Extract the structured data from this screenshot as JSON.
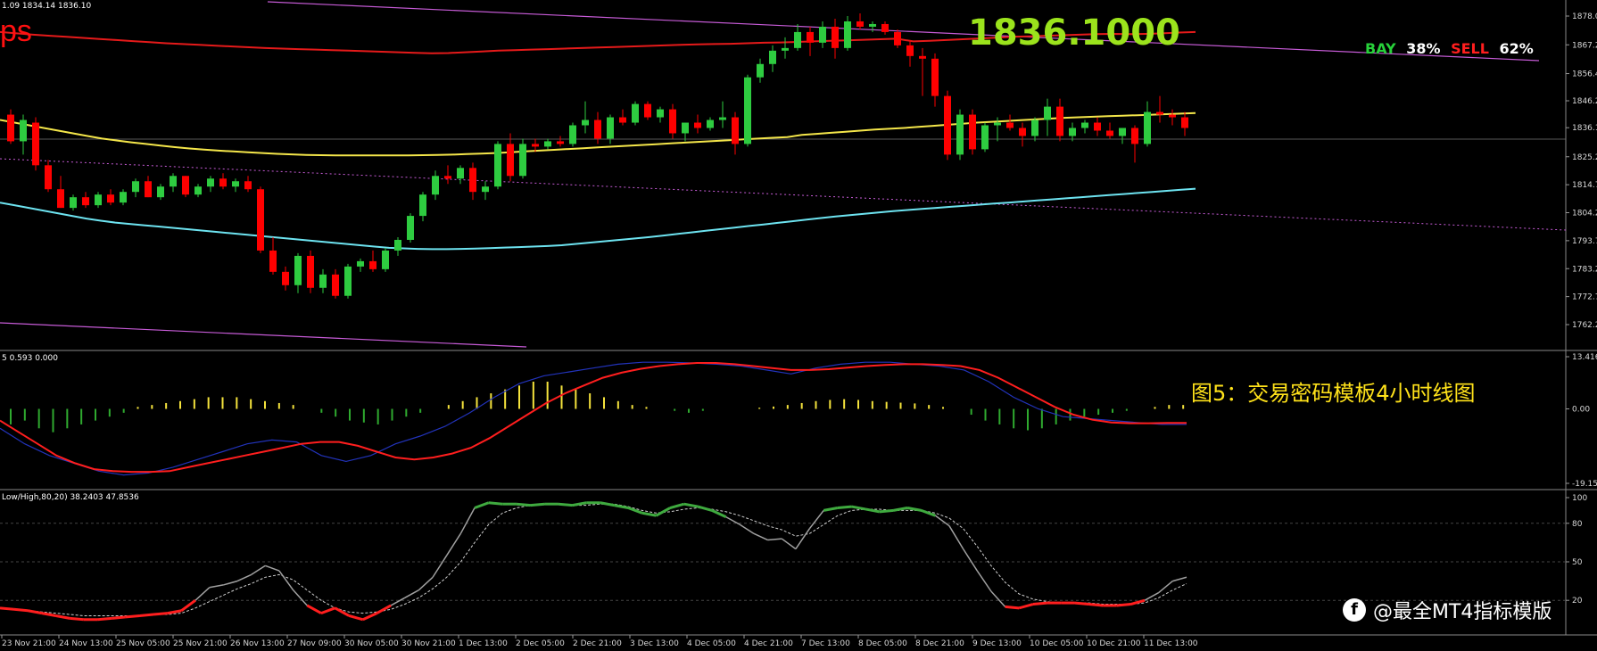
{
  "chart_header": {
    "main_info": "1.09 1834.14 1836.10",
    "logo_fragment": "ps",
    "current_price": "1836.1000",
    "buy_label": "BAY",
    "buy_pct": "38%",
    "sell_label": "SELL",
    "sell_pct": "62%",
    "macd_info": "5 0.593 0.000",
    "stoch_info": "Low/High,80,20) 38.2403 47.8536"
  },
  "caption": "图5：交易密码模板4小时线图",
  "watermark": "@最全MT4指标模版",
  "price_axis": [
    "1878.00",
    "1867.20",
    "1856.40",
    "1846.20",
    "1836.10",
    "1825.20",
    "1814.70",
    "1804.20",
    "1793.70",
    "1783.20",
    "1772.70",
    "1762.20"
  ],
  "macd_axis": [
    "13.416",
    "0.00",
    "-19.15"
  ],
  "stoch_axis": [
    "100",
    "80",
    "50",
    "20",
    "0"
  ],
  "time_axis": [
    "23 Nov 21:00",
    "24 Nov 13:00",
    "25 Nov 05:00",
    "25 Nov 21:00",
    "26 Nov 13:00",
    "27 Nov 09:00",
    "30 Nov 05:00",
    "30 Nov 21:00",
    "1 Dec 13:00",
    "2 Dec 05:00",
    "2 Dec 21:00",
    "3 Dec 13:00",
    "4 Dec 05:00",
    "4 Dec 21:00",
    "7 Dec 13:00",
    "8 Dec 05:00",
    "8 Dec 21:00",
    "9 Dec 13:00",
    "10 Dec 05:00",
    "10 Dec 21:00",
    "11 Dec 13:00"
  ],
  "colors": {
    "bull": "#2ecc40",
    "bear": "#ff0000",
    "ma_red": "#e51a1a",
    "ma_yellow": "#f4e64a",
    "ma_cyan": "#6de3f0",
    "channel_violet": "#c65bd6",
    "macd_bar_pos": "#f5e33c",
    "macd_bar_neg": "#2faa2f",
    "macd_signal": "#ff1e1e",
    "macd_main": "#2233bb",
    "stoch_main_grey": "#a0a0a0",
    "stoch_hot": "#3faa3f",
    "stoch_cold": "#ff1e1e",
    "grid": "#3a3a3a",
    "accent_green": "#9be31c",
    "caption_yellow": "#ffe21a"
  },
  "chart_data": [
    {
      "type": "candlestick",
      "title": "",
      "ylim": [
        1762.2,
        1878.0
      ],
      "candles": [
        [
          1841,
          1843,
          1830,
          1831
        ],
        [
          1831,
          1841,
          1826,
          1839
        ],
        [
          1838,
          1840,
          1820,
          1822
        ],
        [
          1822,
          1824,
          1812,
          1813
        ],
        [
          1813,
          1818,
          1806,
          1806
        ],
        [
          1806,
          1811,
          1805,
          1810
        ],
        [
          1810,
          1812,
          1806,
          1807
        ],
        [
          1807,
          1812,
          1806,
          1811
        ],
        [
          1811,
          1813,
          1807,
          1808
        ],
        [
          1808,
          1813,
          1807,
          1812
        ],
        [
          1812,
          1817,
          1810,
          1816
        ],
        [
          1816,
          1818,
          1810,
          1810
        ],
        [
          1810,
          1815,
          1809,
          1814
        ],
        [
          1814,
          1819,
          1812,
          1818
        ],
        [
          1818,
          1818,
          1810,
          1811
        ],
        [
          1811,
          1815,
          1810,
          1814
        ],
        [
          1814,
          1818,
          1812,
          1817
        ],
        [
          1817,
          1819,
          1813,
          1814
        ],
        [
          1814,
          1817,
          1812,
          1816
        ],
        [
          1816,
          1818,
          1812,
          1813
        ],
        [
          1813,
          1814,
          1789,
          1790
        ],
        [
          1790,
          1795,
          1781,
          1782
        ],
        [
          1782,
          1784,
          1775,
          1777
        ],
        [
          1777,
          1789,
          1774,
          1788
        ],
        [
          1788,
          1790,
          1774,
          1776
        ],
        [
          1776,
          1783,
          1774,
          1781
        ],
        [
          1781,
          1783,
          1772,
          1773
        ],
        [
          1773,
          1785,
          1772,
          1784
        ],
        [
          1784,
          1787,
          1782,
          1786
        ],
        [
          1786,
          1790,
          1782,
          1783
        ],
        [
          1783,
          1791,
          1782,
          1790
        ],
        [
          1790,
          1795,
          1788,
          1794
        ],
        [
          1794,
          1804,
          1793,
          1803
        ],
        [
          1803,
          1812,
          1801,
          1811
        ],
        [
          1811,
          1820,
          1809,
          1818
        ],
        [
          1818,
          1822,
          1815,
          1817
        ],
        [
          1817,
          1822,
          1815,
          1821
        ],
        [
          1821,
          1823,
          1809,
          1812
        ],
        [
          1812,
          1816,
          1809,
          1814
        ],
        [
          1814,
          1831,
          1813,
          1830
        ],
        [
          1830,
          1834,
          1816,
          1818
        ],
        [
          1818,
          1832,
          1817,
          1830
        ],
        [
          1830,
          1832,
          1827,
          1829
        ],
        [
          1829,
          1832,
          1828,
          1831
        ],
        [
          1831,
          1833,
          1829,
          1830
        ],
        [
          1830,
          1838,
          1829,
          1837
        ],
        [
          1837,
          1846,
          1834,
          1839
        ],
        [
          1839,
          1842,
          1830,
          1832
        ],
        [
          1832,
          1841,
          1830,
          1840
        ],
        [
          1840,
          1843,
          1837,
          1838
        ],
        [
          1838,
          1846,
          1837,
          1845
        ],
        [
          1845,
          1846,
          1839,
          1840
        ],
        [
          1840,
          1844,
          1838,
          1843
        ],
        [
          1843,
          1845,
          1832,
          1834
        ],
        [
          1834,
          1838,
          1831,
          1838
        ],
        [
          1838,
          1841,
          1834,
          1836
        ],
        [
          1836,
          1840,
          1835,
          1839
        ],
        [
          1839,
          1846,
          1836,
          1840
        ],
        [
          1840,
          1842,
          1826,
          1830
        ],
        [
          1830,
          1856,
          1829,
          1855
        ],
        [
          1855,
          1862,
          1853,
          1860
        ],
        [
          1860,
          1867,
          1857,
          1865
        ],
        [
          1865,
          1870,
          1862,
          1866
        ],
        [
          1866,
          1875,
          1865,
          1872
        ],
        [
          1872,
          1874,
          1863,
          1868
        ],
        [
          1868,
          1876,
          1866,
          1874
        ],
        [
          1874,
          1877,
          1862,
          1866
        ],
        [
          1866,
          1878,
          1865,
          1876
        ],
        [
          1876,
          1879,
          1873,
          1874
        ],
        [
          1874,
          1876,
          1872,
          1875
        ],
        [
          1875,
          1876,
          1871,
          1872
        ],
        [
          1872,
          1873,
          1866,
          1867
        ],
        [
          1867,
          1869,
          1859,
          1863
        ],
        [
          1863,
          1866,
          1848,
          1862
        ],
        [
          1862,
          1864,
          1844,
          1848
        ],
        [
          1848,
          1850,
          1824,
          1826
        ],
        [
          1826,
          1843,
          1824,
          1841
        ],
        [
          1841,
          1843,
          1826,
          1828
        ],
        [
          1828,
          1838,
          1827,
          1837
        ],
        [
          1837,
          1840,
          1831,
          1838
        ],
        [
          1838,
          1841,
          1835,
          1836
        ],
        [
          1836,
          1838,
          1829,
          1833
        ],
        [
          1833,
          1840,
          1831,
          1839
        ],
        [
          1839,
          1847,
          1833,
          1844
        ],
        [
          1844,
          1847,
          1831,
          1833
        ],
        [
          1833,
          1838,
          1831,
          1836
        ],
        [
          1836,
          1839,
          1834,
          1838
        ],
        [
          1838,
          1840,
          1833,
          1835
        ],
        [
          1835,
          1838,
          1832,
          1833
        ],
        [
          1833,
          1836,
          1830,
          1836
        ],
        [
          1836,
          1837,
          1823,
          1830
        ],
        [
          1830,
          1846,
          1829,
          1842
        ],
        [
          1842,
          1848,
          1838,
          1841
        ],
        [
          1841,
          1843,
          1837,
          1840
        ],
        [
          1840,
          1842,
          1833,
          1836
        ]
      ],
      "ma_red": [
        1872,
        1871.5,
        1871,
        1870.6,
        1870.2,
        1869.8,
        1869.4,
        1869,
        1868.6,
        1868.2,
        1867.8,
        1867.5,
        1867.2,
        1866.9,
        1866.6,
        1866.3,
        1866,
        1865.8,
        1865.6,
        1865.4,
        1865.2,
        1865,
        1864.8,
        1864.6,
        1864.4,
        1864.2,
        1864,
        1864.1,
        1864.4,
        1864.7,
        1865,
        1865.2,
        1865.4,
        1865.6,
        1865.8,
        1866,
        1866.2,
        1866.4,
        1866.6,
        1866.8,
        1867,
        1867.2,
        1867.4,
        1867.5,
        1867.6,
        1867.8,
        1868,
        1868.1,
        1868.3,
        1868.5,
        1868.7,
        1868.9,
        1869.1,
        1869.3,
        1869.5,
        1868.5,
        1868.7,
        1869,
        1869.3,
        1869.6,
        1869.9,
        1870.2,
        1870.4,
        1870.6,
        1870.8,
        1871,
        1871.2,
        1871.3,
        1871.2,
        1871.3,
        1871.5,
        1871.8,
        1872
      ],
      "ma_yellow": [
        1839,
        1838,
        1837,
        1836,
        1835,
        1834,
        1833,
        1832,
        1831.3,
        1830.6,
        1830,
        1829.4,
        1828.8,
        1828.3,
        1827.9,
        1827.5,
        1827.2,
        1826.9,
        1826.6,
        1826.3,
        1826.1,
        1825.9,
        1825.8,
        1825.7,
        1825.7,
        1825.7,
        1825.7,
        1825.7,
        1825.7,
        1825.8,
        1825.9,
        1826,
        1826.2,
        1826.4,
        1826.6,
        1826.9,
        1827.2,
        1827.5,
        1827.8,
        1828.1,
        1828.4,
        1828.7,
        1829,
        1829.3,
        1829.6,
        1829.9,
        1830.2,
        1830.5,
        1830.8,
        1831.1,
        1831.4,
        1831.7,
        1832,
        1832.3,
        1832.6,
        1833.4,
        1833.8,
        1834.2,
        1834.6,
        1835,
        1835.4,
        1835.7,
        1836,
        1836.4,
        1836.8,
        1837.2,
        1837.6,
        1838,
        1838.3,
        1838.6,
        1838.9,
        1839.2,
        1839.5,
        1839.8,
        1840,
        1840.2,
        1840.4,
        1840.6,
        1840.8,
        1841,
        1841.2,
        1841.4,
        1841.6
      ],
      "ma_cyan": [
        1808,
        1807,
        1806,
        1805,
        1804,
        1803,
        1802,
        1801.2,
        1800.5,
        1800,
        1799.5,
        1799,
        1798.5,
        1798,
        1797.5,
        1797,
        1796.5,
        1796,
        1795.5,
        1795,
        1794.5,
        1794,
        1793.5,
        1793,
        1792.5,
        1792,
        1791.5,
        1791,
        1790.8,
        1790.6,
        1790.5,
        1790.5,
        1790.6,
        1790.7,
        1790.9,
        1791.1,
        1791.3,
        1791.5,
        1791.7,
        1792,
        1792.5,
        1793,
        1793.5,
        1794,
        1794.5,
        1795,
        1795.6,
        1796.2,
        1796.8,
        1797.4,
        1798,
        1798.6,
        1799.2,
        1799.8,
        1800.4,
        1801,
        1801.6,
        1802.2,
        1802.8,
        1803.3,
        1803.8,
        1804.3,
        1804.8,
        1805.2,
        1805.6,
        1806,
        1806.4,
        1806.8,
        1807.2,
        1807.6,
        1808,
        1808.4,
        1808.8,
        1809.2,
        1809.6,
        1810,
        1810.4,
        1810.8,
        1811.2,
        1811.6,
        1812,
        1812.4,
        1812.8,
        1813.2
      ]
    },
    {
      "type": "bar",
      "title": "MACD",
      "ylim": [
        -19.15,
        13.416
      ],
      "hist": [
        -4,
        -3,
        -5,
        -6,
        -5,
        -4,
        -3,
        -2,
        -1,
        0.5,
        1,
        1.5,
        2,
        2.5,
        3,
        3,
        3,
        2.5,
        2,
        1.5,
        1,
        0,
        -1,
        -2,
        -3,
        -3.5,
        -4,
        -3,
        -2,
        -1,
        0,
        1,
        2,
        3,
        4,
        5,
        6,
        7,
        7,
        6,
        5,
        4,
        3,
        2,
        1,
        0.5,
        0,
        -0.5,
        -1,
        -0.5,
        0,
        0,
        0,
        0.3,
        0.6,
        1,
        1.5,
        2,
        2.3,
        2.5,
        2.3,
        2,
        1.8,
        1.6,
        1.4,
        1,
        0.5,
        0,
        -1.5,
        -3,
        -4,
        -5,
        -5.5,
        -5,
        -4,
        -3,
        -2,
        -1.5,
        -1,
        -0.5,
        0,
        0.5,
        1,
        1
      ],
      "signal": [
        -3,
        -6,
        -9,
        -12,
        -14,
        -15.5,
        -16,
        -16.2,
        -16.2,
        -16,
        -15,
        -14,
        -13,
        -12,
        -11,
        -10,
        -9,
        -8.5,
        -8.5,
        -9.5,
        -11,
        -12.5,
        -13,
        -12.5,
        -11.5,
        -10,
        -7.5,
        -4.5,
        -1.5,
        1.5,
        4,
        6,
        8,
        9.3,
        10.3,
        11,
        11.5,
        11.8,
        11.8,
        11.5,
        11,
        10.5,
        10,
        10,
        10.2,
        10.6,
        11,
        11.3,
        11.5,
        11.5,
        11.3,
        11,
        10,
        8,
        5.5,
        3,
        0.5,
        -1.5,
        -2.8,
        -3.5,
        -3.7,
        -3.7,
        -3.6,
        -3.6
      ],
      "main": [
        -5,
        -9,
        -12,
        -14,
        -16,
        -17,
        -16.5,
        -15,
        -13,
        -11,
        -9,
        -8,
        -8.5,
        -12,
        -13.5,
        -12,
        -9,
        -7,
        -4.5,
        -1,
        3,
        6.5,
        8.5,
        9.5,
        10.5,
        11.5,
        12,
        12,
        11.8,
        11.5,
        11,
        10,
        9,
        10.5,
        11.5,
        12,
        12,
        11.5,
        11,
        10,
        7,
        3,
        0,
        -2,
        -2.5,
        -3,
        -3.5,
        -4,
        -4
      ]
    },
    {
      "type": "line",
      "title": "Stochastic",
      "ylim": [
        0,
        100
      ],
      "k": [
        14,
        13,
        12,
        10,
        8,
        6,
        5,
        5,
        6,
        7,
        8,
        9,
        10,
        12,
        20,
        30,
        32,
        35,
        40,
        47,
        43,
        28,
        16,
        10,
        14,
        8,
        5,
        10,
        16,
        22,
        28,
        38,
        55,
        72,
        92,
        96,
        95,
        95,
        94,
        95,
        95,
        94,
        96,
        96,
        94,
        92,
        88,
        86,
        92,
        95,
        93,
        90,
        85,
        79,
        72,
        67,
        68,
        60,
        76,
        90,
        92,
        93,
        91,
        89,
        90,
        92,
        90,
        86,
        78,
        60,
        43,
        27,
        15,
        14,
        17,
        18,
        18,
        18,
        17,
        16,
        16,
        17,
        20,
        26,
        35,
        38
      ],
      "d": [
        14,
        13,
        12,
        11,
        10,
        9,
        8,
        8,
        8,
        8,
        8,
        9,
        9,
        10,
        14,
        19,
        24,
        29,
        33,
        38,
        40,
        36,
        28,
        20,
        14,
        11,
        10,
        11,
        13,
        17,
        22,
        29,
        38,
        50,
        65,
        79,
        88,
        92,
        94,
        95,
        95,
        94,
        94,
        95,
        95,
        93,
        90,
        88,
        89,
        91,
        92,
        91,
        89,
        86,
        82,
        78,
        75,
        70,
        72,
        79,
        86,
        90,
        91,
        91,
        90,
        90,
        90,
        88,
        84,
        76,
        62,
        47,
        34,
        25,
        21,
        19,
        18,
        18,
        18,
        17,
        17,
        17,
        18,
        22,
        28,
        33
      ]
    }
  ]
}
